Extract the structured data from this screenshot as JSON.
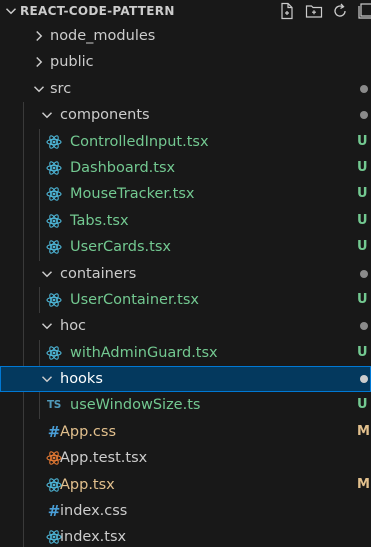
{
  "explorer": {
    "root_title": "REACT-CODE-PATTERN",
    "actions": [
      {
        "name": "new-file-icon"
      },
      {
        "name": "new-folder-icon"
      },
      {
        "name": "refresh-icon"
      },
      {
        "name": "collapse-all-icon"
      }
    ]
  },
  "colors": {
    "background": "#181818",
    "text": "#cccccc",
    "untracked": "#73c991",
    "modified": "#e2c08d",
    "selection_bg": "#04395e",
    "selection_border": "#0078d4",
    "react_icon": "#4db5d6",
    "test_icon": "#e37933",
    "css_icon": "#4a9fd8",
    "ts_icon": "#519aba"
  },
  "tree": [
    {
      "label": "node_modules",
      "type": "folder",
      "expanded": false,
      "depth": 0,
      "status": null,
      "icon": null
    },
    {
      "label": "public",
      "type": "folder",
      "expanded": false,
      "depth": 0,
      "status": null,
      "icon": null
    },
    {
      "label": "src",
      "type": "folder",
      "expanded": true,
      "depth": 0,
      "status": "dot",
      "icon": null
    },
    {
      "label": "components",
      "type": "folder",
      "expanded": true,
      "depth": 1,
      "status": "dot",
      "icon": null
    },
    {
      "label": "ControlledInput.tsx",
      "type": "file",
      "depth": 2,
      "status": "U",
      "icon": "react-icon"
    },
    {
      "label": "Dashboard.tsx",
      "type": "file",
      "depth": 2,
      "status": "U",
      "icon": "react-icon"
    },
    {
      "label": "MouseTracker.tsx",
      "type": "file",
      "depth": 2,
      "status": "U",
      "icon": "react-icon"
    },
    {
      "label": "Tabs.tsx",
      "type": "file",
      "depth": 2,
      "status": "U",
      "icon": "react-icon"
    },
    {
      "label": "UserCards.tsx",
      "type": "file",
      "depth": 2,
      "status": "U",
      "icon": "react-icon"
    },
    {
      "label": "containers",
      "type": "folder",
      "expanded": true,
      "depth": 1,
      "status": "dot",
      "icon": null
    },
    {
      "label": "UserContainer.tsx",
      "type": "file",
      "depth": 2,
      "status": "U",
      "icon": "react-icon"
    },
    {
      "label": "hoc",
      "type": "folder",
      "expanded": true,
      "depth": 1,
      "status": "dot",
      "icon": null
    },
    {
      "label": "withAdminGuard.tsx",
      "type": "file",
      "depth": 2,
      "status": "U",
      "icon": "react-icon"
    },
    {
      "label": "hooks",
      "type": "folder",
      "expanded": true,
      "depth": 1,
      "status": "dot",
      "icon": null,
      "selected": true
    },
    {
      "label": "useWindowSize.ts",
      "type": "file",
      "depth": 2,
      "status": "U",
      "icon": "typescript-icon",
      "icon_text": "TS"
    },
    {
      "label": "App.css",
      "type": "file",
      "depth": 1,
      "status": "M",
      "icon": "css-hash-icon",
      "icon_text": "#"
    },
    {
      "label": "App.test.tsx",
      "type": "file",
      "depth": 1,
      "status": null,
      "icon": "react-test-icon"
    },
    {
      "label": "App.tsx",
      "type": "file",
      "depth": 1,
      "status": "M",
      "icon": "react-icon"
    },
    {
      "label": "index.css",
      "type": "file",
      "depth": 1,
      "status": null,
      "icon": "css-hash-icon",
      "icon_text": "#"
    },
    {
      "label": "index.tsx",
      "type": "file",
      "depth": 1,
      "status": null,
      "icon": "react-icon"
    }
  ]
}
